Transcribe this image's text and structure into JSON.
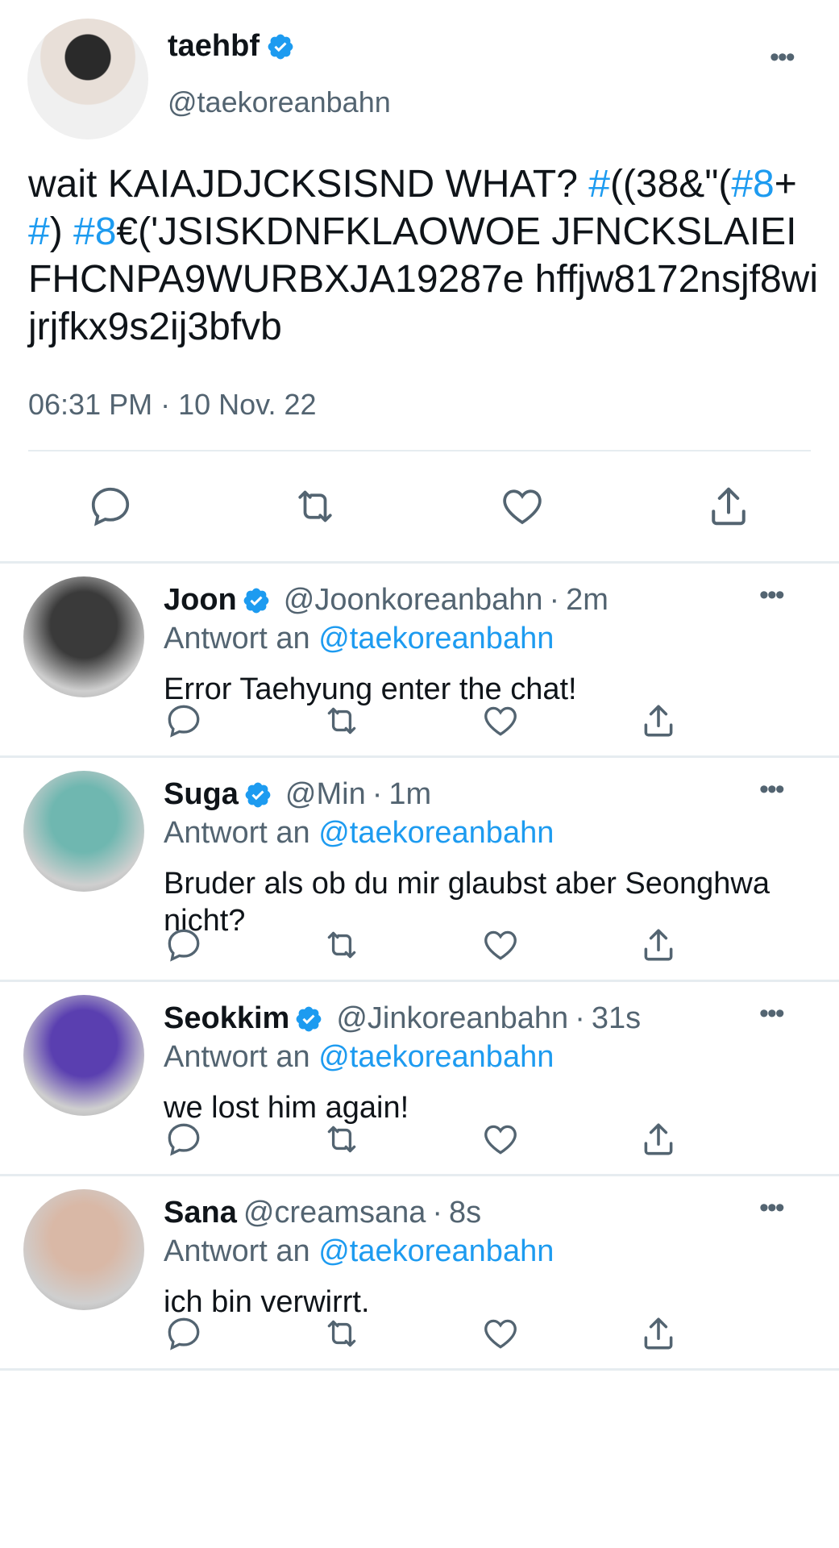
{
  "main_tweet": {
    "name": "taehbf",
    "handle": "@taekoreanbahn",
    "text_parts": [
      {
        "t": "wait KAIAJDJCKSISND WHAT? ",
        "hash": false
      },
      {
        "t": "#",
        "hash": true
      },
      {
        "t": "((38&\"(",
        "hash": false
      },
      {
        "t": "#8",
        "hash": true
      },
      {
        "t": "+",
        "hash": false
      },
      {
        "t": "#",
        "hash": true
      },
      {
        "t": ") ",
        "hash": false
      },
      {
        "t": "#8",
        "hash": true
      },
      {
        "t": "€('JSISKDNFKLAOWOE JFNCKSLAIEIFHCNPA9WURBXJA19287e hffjw8172nsjf8wijrjfkx9s2ij3bfvb",
        "hash": false
      }
    ],
    "timestamp": "06:31 PM · 10 Nov. 22",
    "more_icon": "more-horizontal-icon",
    "actions": [
      "reply-icon",
      "retweet-icon",
      "like-icon",
      "share-icon"
    ]
  },
  "replies": [
    {
      "name": "Joon",
      "verified": true,
      "handle": "@Joonkoreanbahn",
      "time": "2m",
      "reply_prefix": "Antwort an",
      "reply_to": "@taekoreanbahn",
      "text": "Error Taehyung enter the chat!",
      "avatar_color": "#3a3a3a"
    },
    {
      "name": "Suga",
      "verified": true,
      "handle": "@Min",
      "time": "1m",
      "reply_prefix": "Antwort an",
      "reply_to": "@taekoreanbahn",
      "text": "Bruder als ob du mir glaubst aber Seonghwa nicht?",
      "avatar_color": "#6fb7b0"
    },
    {
      "name": "Seokkim",
      "verified": true,
      "handle": "@Jinkoreanbahn",
      "time": "31s",
      "reply_prefix": "Antwort an",
      "reply_to": "@taekoreanbahn",
      "text": "we lost him again!",
      "avatar_color": "#5a3fb0"
    },
    {
      "name": "Sana",
      "verified": false,
      "handle": "@creamsana",
      "time": "8s",
      "reply_prefix": "Antwort an",
      "reply_to": "@taekoreanbahn",
      "text": "ich bin verwirrt.",
      "avatar_color": "#d9b8a6"
    }
  ],
  "colors": {
    "accent": "#1d9bf0",
    "muted": "#536471",
    "text": "#0f1419",
    "divider": "#e6ecf0"
  }
}
